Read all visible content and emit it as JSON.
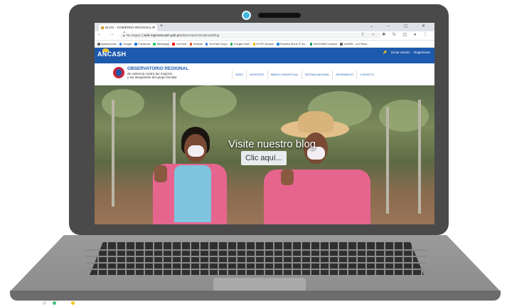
{
  "browser": {
    "tab_title": "BLOG - GOBIERNO REGIONAL D",
    "tab_close": "×",
    "new_tab": "+",
    "window_controls": "⌄ – ▢ ✕",
    "nav_buttons": "← → C",
    "security_label": "No seguro",
    "url_host": "web.regionancash.gob.pe",
    "url_path": "/observatorio/violencia/blog",
    "ext_icons": "⇪ ☆ ✱ ℕ ◫ ● ⋮",
    "bookmarks": [
      {
        "label": "Aplicaciones",
        "color": "#5f6368"
      },
      {
        "label": "Google",
        "color": "#4285f4"
      },
      {
        "label": "Facebook",
        "color": "#1877f2"
      },
      {
        "label": "WhatsApp",
        "color": "#25d366"
      },
      {
        "label": "YouTube",
        "color": "#ff0000"
      },
      {
        "label": "Hotmail",
        "color": "#f25022"
      },
      {
        "label": "YouTube Dupp",
        "color": "#4285f4"
      },
      {
        "label": "Google Earth",
        "color": "#34a853"
      },
      {
        "label": "ECPE Áncash",
        "color": "#f4b400"
      },
      {
        "label": "Rosetta Stone ® Sa...",
        "color": "#1e88e5"
      },
      {
        "label": "SEGUNDO emmas",
        "color": "#0f9d58"
      },
      {
        "label": "VivaPlit - La Primer...",
        "color": "#5f6368"
      }
    ]
  },
  "site": {
    "brand": "ANCASH",
    "login": "Iniciar Sesión",
    "register": "Registrarse",
    "org_title": "OBSERVATORIO REGIONAL",
    "org_sub1": "de violencia contra las mujeres",
    "org_sub2": "y los integrantes del grupo familiar",
    "menu": [
      "INICIO",
      "NOSOTROS",
      "MARCO CONCEPTUAL",
      "SISTEMA NACIONAL",
      "INFORMATIVO",
      "CONTACTO"
    ],
    "hero_heading": "Visite nuestro blog",
    "hero_cta": "Clic aquí..."
  },
  "colors": {
    "brand_blue": "#1d59ad",
    "brand_red": "#c7253a",
    "cta_bg": "#e9ecef"
  }
}
